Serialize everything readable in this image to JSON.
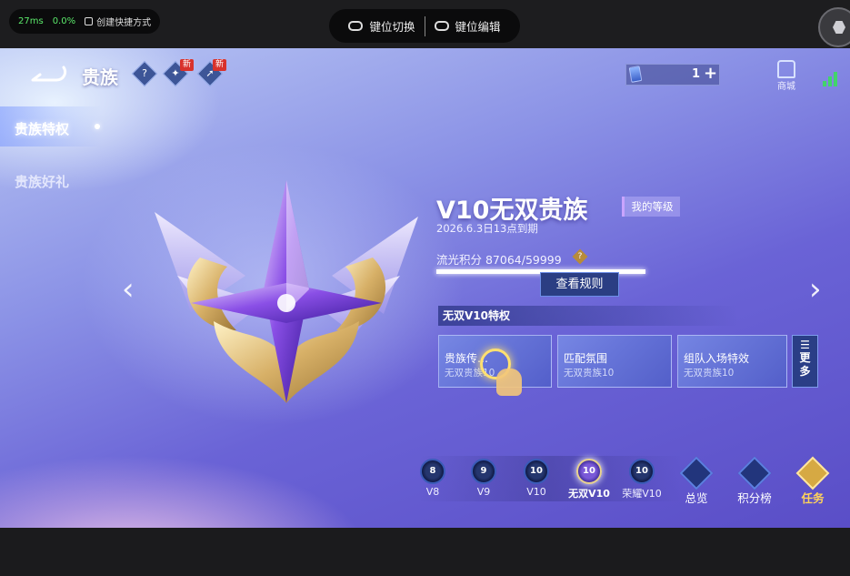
{
  "emulator": {
    "latency": "27ms",
    "loss": "0.0%",
    "shortcut_label": "创建快捷方式",
    "key_map_label": "键位切换",
    "key_edit_label": "键位编辑"
  },
  "header": {
    "title": "贵族",
    "help_label": "?",
    "new_badge": "新",
    "currency_amount": "1",
    "plus_label": "+",
    "shop_label": "商城"
  },
  "sidebar": {
    "items": [
      {
        "label": "贵族特权"
      },
      {
        "label": "贵族好礼"
      }
    ]
  },
  "rank": {
    "name": "V10无双贵族",
    "my_level_label": "我的等级",
    "expire_text": "2026.6.3日13点到期",
    "points_text": "流光积分 87064/59999",
    "points_help": "?",
    "progress": 1.0,
    "rules_button": "查看规则"
  },
  "privileges": {
    "title": "无双V10特权",
    "cards": [
      {
        "name": "贵族传…",
        "sub": "无双贵族10"
      },
      {
        "name": "匹配氛围",
        "sub": "无双贵族10"
      },
      {
        "name": "组队入场特效",
        "sub": "无双贵族10"
      }
    ],
    "more_line1": "更",
    "more_line2": "多"
  },
  "levels": [
    {
      "badge": "8",
      "label": "V8"
    },
    {
      "badge": "9",
      "label": "V9"
    },
    {
      "badge": "10",
      "label": "V10"
    },
    {
      "badge": "10",
      "label": "无双V10"
    },
    {
      "badge": "10",
      "label": "荣耀V10"
    }
  ],
  "nav": {
    "overview": "总览",
    "leaderboard": "积分榜",
    "task": "任务"
  },
  "colors": {
    "accent": "#6a63d6",
    "gold": "#d6a943",
    "latency_green": "#5be86a"
  }
}
